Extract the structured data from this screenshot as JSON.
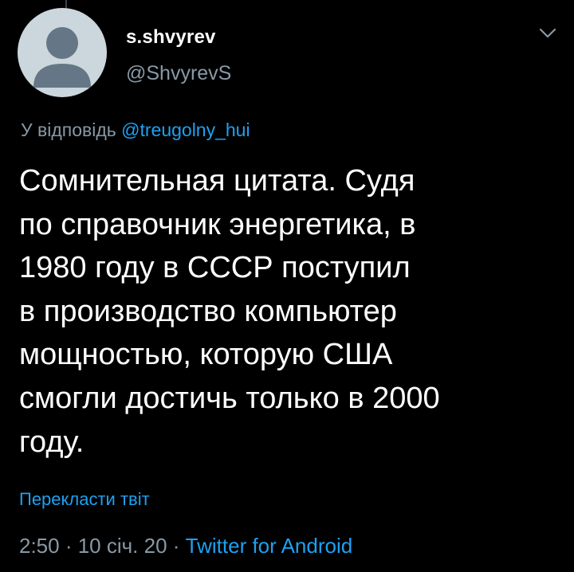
{
  "colors": {
    "background": "#000000",
    "text": "#ffffff",
    "muted": "#8899a6",
    "accent": "#1da1f2",
    "avatar_bg": "#ccd6dd",
    "avatar_fg": "#657786"
  },
  "user": {
    "display_name": "s.shvyrev",
    "handle": "@ShvyrevS",
    "avatar_icon": "default-person-icon"
  },
  "more_icon": "chevron-down-icon",
  "reply": {
    "prefix": "У відповідь ",
    "mention": "@treugolny_hui"
  },
  "tweet": {
    "lines": [
      "Сомнительная цитата. Судя",
      "по справочник энергетика, в",
      "1980 году в СССР поступил",
      "в производство компьютер",
      "мощностью, которую США",
      "смогли достичь только в 2000",
      "году."
    ]
  },
  "translate_label": "Перекласти твіт",
  "meta": {
    "time": "2:50",
    "sep1": " · ",
    "date": "10 січ. 20",
    "sep2": " · ",
    "source": "Twitter for Android"
  }
}
